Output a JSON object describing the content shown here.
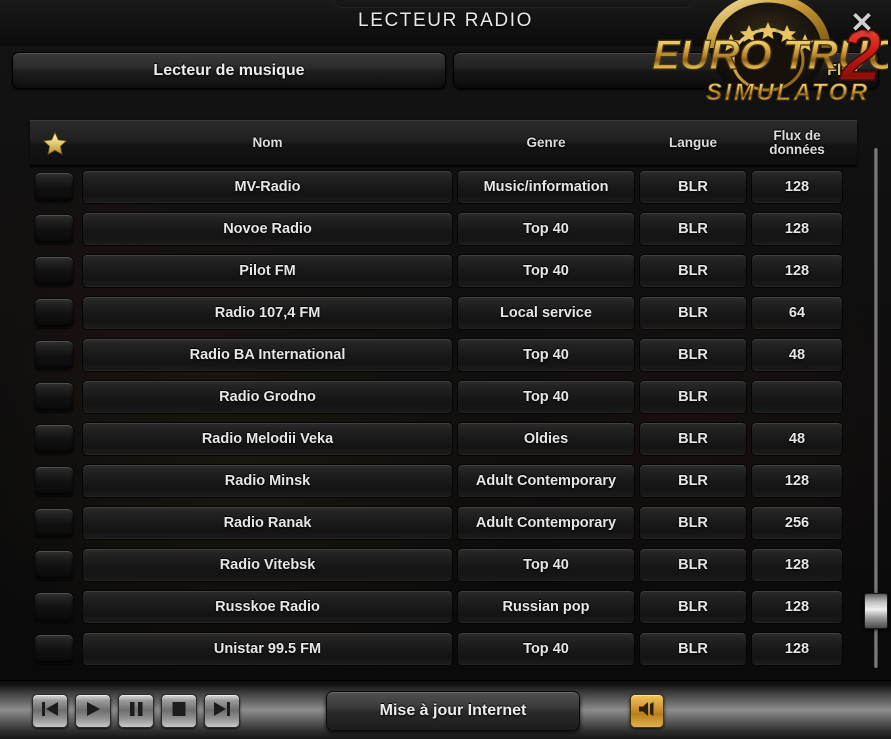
{
  "window": {
    "title": "LECTEUR RADIO",
    "close_label": "✕",
    "close_icon": "close-icon"
  },
  "branding": {
    "logo_line1": "EURO TRUCK",
    "logo_number": "2",
    "logo_line2": "SIMULATOR"
  },
  "tabs": [
    {
      "label": "Lecteur de musique",
      "active": true
    },
    {
      "label": "Flux",
      "active": false
    }
  ],
  "table": {
    "headers": {
      "favorite": "",
      "favorite_icon": "star-icon",
      "name": "Nom",
      "genre": "Genre",
      "language": "Langue",
      "bitrate": "Flux de données"
    },
    "rows": [
      {
        "favorite": false,
        "name": "MV-Radio",
        "genre": "Music/information",
        "language": "BLR",
        "bitrate": "128"
      },
      {
        "favorite": false,
        "name": "Novoe Radio",
        "genre": "Top 40",
        "language": "BLR",
        "bitrate": "128"
      },
      {
        "favorite": false,
        "name": "Pilot FM",
        "genre": "Top 40",
        "language": "BLR",
        "bitrate": "128"
      },
      {
        "favorite": false,
        "name": "Radio 107,4 FM",
        "genre": "Local service",
        "language": "BLR",
        "bitrate": "64"
      },
      {
        "favorite": false,
        "name": "Radio BA International",
        "genre": "Top 40",
        "language": "BLR",
        "bitrate": "48"
      },
      {
        "favorite": false,
        "name": "Radio Grodno",
        "genre": "Top 40",
        "language": "BLR",
        "bitrate": ""
      },
      {
        "favorite": false,
        "name": "Radio Melodii Veka",
        "genre": "Oldies",
        "language": "BLR",
        "bitrate": "48"
      },
      {
        "favorite": false,
        "name": "Radio Minsk",
        "genre": "Adult Contemporary",
        "language": "BLR",
        "bitrate": "128"
      },
      {
        "favorite": false,
        "name": "Radio Ranak",
        "genre": "Adult Contemporary",
        "language": "BLR",
        "bitrate": "256"
      },
      {
        "favorite": false,
        "name": "Radio Vitebsk",
        "genre": "Top 40",
        "language": "BLR",
        "bitrate": "128"
      },
      {
        "favorite": false,
        "name": "Russkoe Radio",
        "genre": "Russian pop",
        "language": "BLR",
        "bitrate": "128"
      },
      {
        "favorite": false,
        "name": "Unistar 99.5 FM",
        "genre": "Top 40",
        "language": "BLR",
        "bitrate": "128"
      }
    ]
  },
  "scrollbar": {
    "orientation": "vertical",
    "thumb_position_pct": 92
  },
  "transport": [
    {
      "icon": "skip-previous-icon",
      "label": "Précédent"
    },
    {
      "icon": "play-icon",
      "label": "Lecture"
    },
    {
      "icon": "pause-icon",
      "label": "Pause"
    },
    {
      "icon": "stop-icon",
      "label": "Stop"
    },
    {
      "icon": "skip-next-icon",
      "label": "Suivant"
    }
  ],
  "footer": {
    "update_label": "Mise à jour Internet",
    "volume_icon": "volume-icon",
    "volume_pct": 0
  },
  "colors": {
    "accent_gold": "#d9a23c",
    "star_gold": "#e8cf7a",
    "logo_red": "#c8201b",
    "text_primary": "#e6e6e6",
    "panel_dark": "#141414"
  }
}
